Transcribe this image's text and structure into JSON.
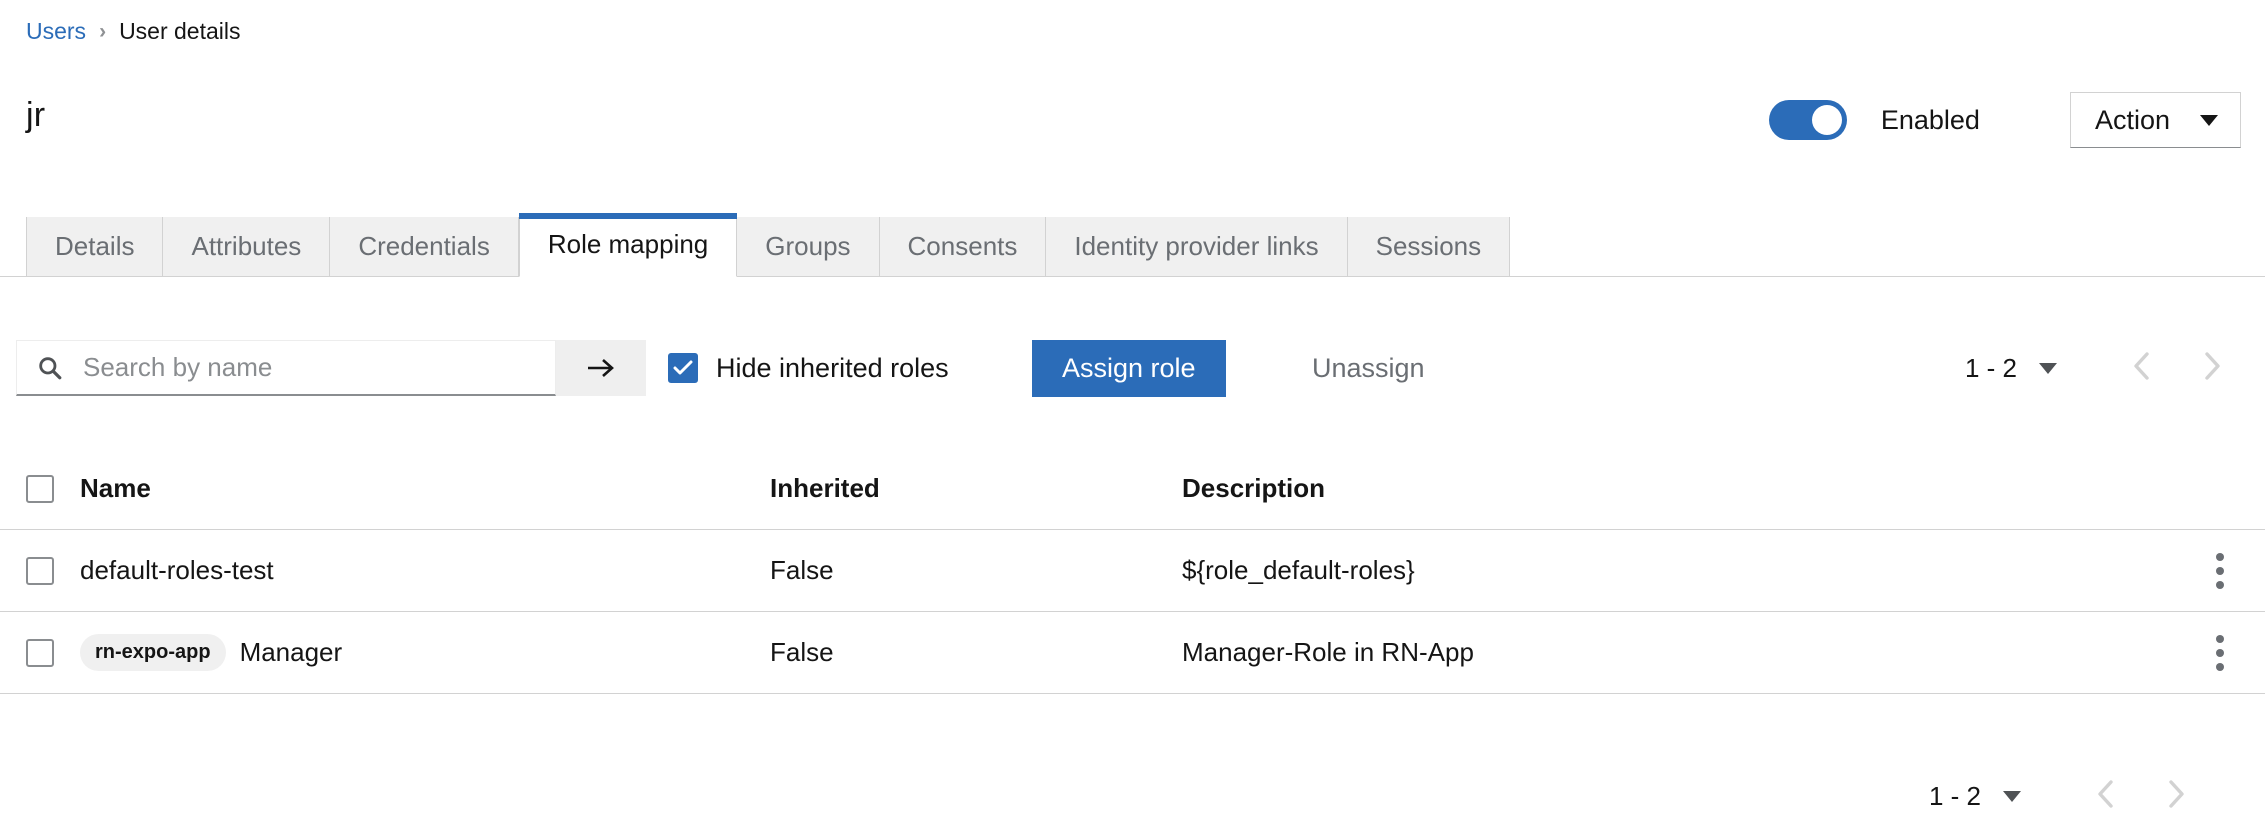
{
  "breadcrumb": {
    "parent": "Users",
    "separator": "›",
    "current": "User details"
  },
  "header": {
    "title": "jr",
    "toggle_label": "Enabled",
    "toggle_on": true,
    "action_label": "Action"
  },
  "tabs": [
    {
      "label": "Details",
      "active": false
    },
    {
      "label": "Attributes",
      "active": false
    },
    {
      "label": "Credentials",
      "active": false
    },
    {
      "label": "Role mapping",
      "active": true
    },
    {
      "label": "Groups",
      "active": false
    },
    {
      "label": "Consents",
      "active": false
    },
    {
      "label": "Identity provider links",
      "active": false
    },
    {
      "label": "Sessions",
      "active": false
    }
  ],
  "toolbar": {
    "search_placeholder": "Search by name",
    "search_value": "",
    "search_icon": "search-icon",
    "submit_icon": "arrow-right-icon",
    "hide_inherited_label": "Hide inherited roles",
    "hide_inherited_checked": true,
    "assign_label": "Assign role",
    "unassign_label": "Unassign"
  },
  "pagination": {
    "range": "1 - 2",
    "prev_icon": "chevron-left-icon",
    "next_icon": "chevron-right-icon"
  },
  "table": {
    "columns": {
      "name": "Name",
      "inherited": "Inherited",
      "description": "Description"
    },
    "rows": [
      {
        "badge": "",
        "name": "default-roles-test",
        "inherited": "False",
        "description": "${role_default-roles}"
      },
      {
        "badge": "rn-expo-app",
        "name": "Manager",
        "inherited": "False",
        "description": "Manager-Role in RN-App"
      }
    ]
  },
  "colors": {
    "accent_blue": "#2b6cb8",
    "link_blue": "#2b6cb8",
    "muted_text": "#6a6e73",
    "border": "#d2d2d2",
    "tab_bg": "#f0f0f0"
  }
}
